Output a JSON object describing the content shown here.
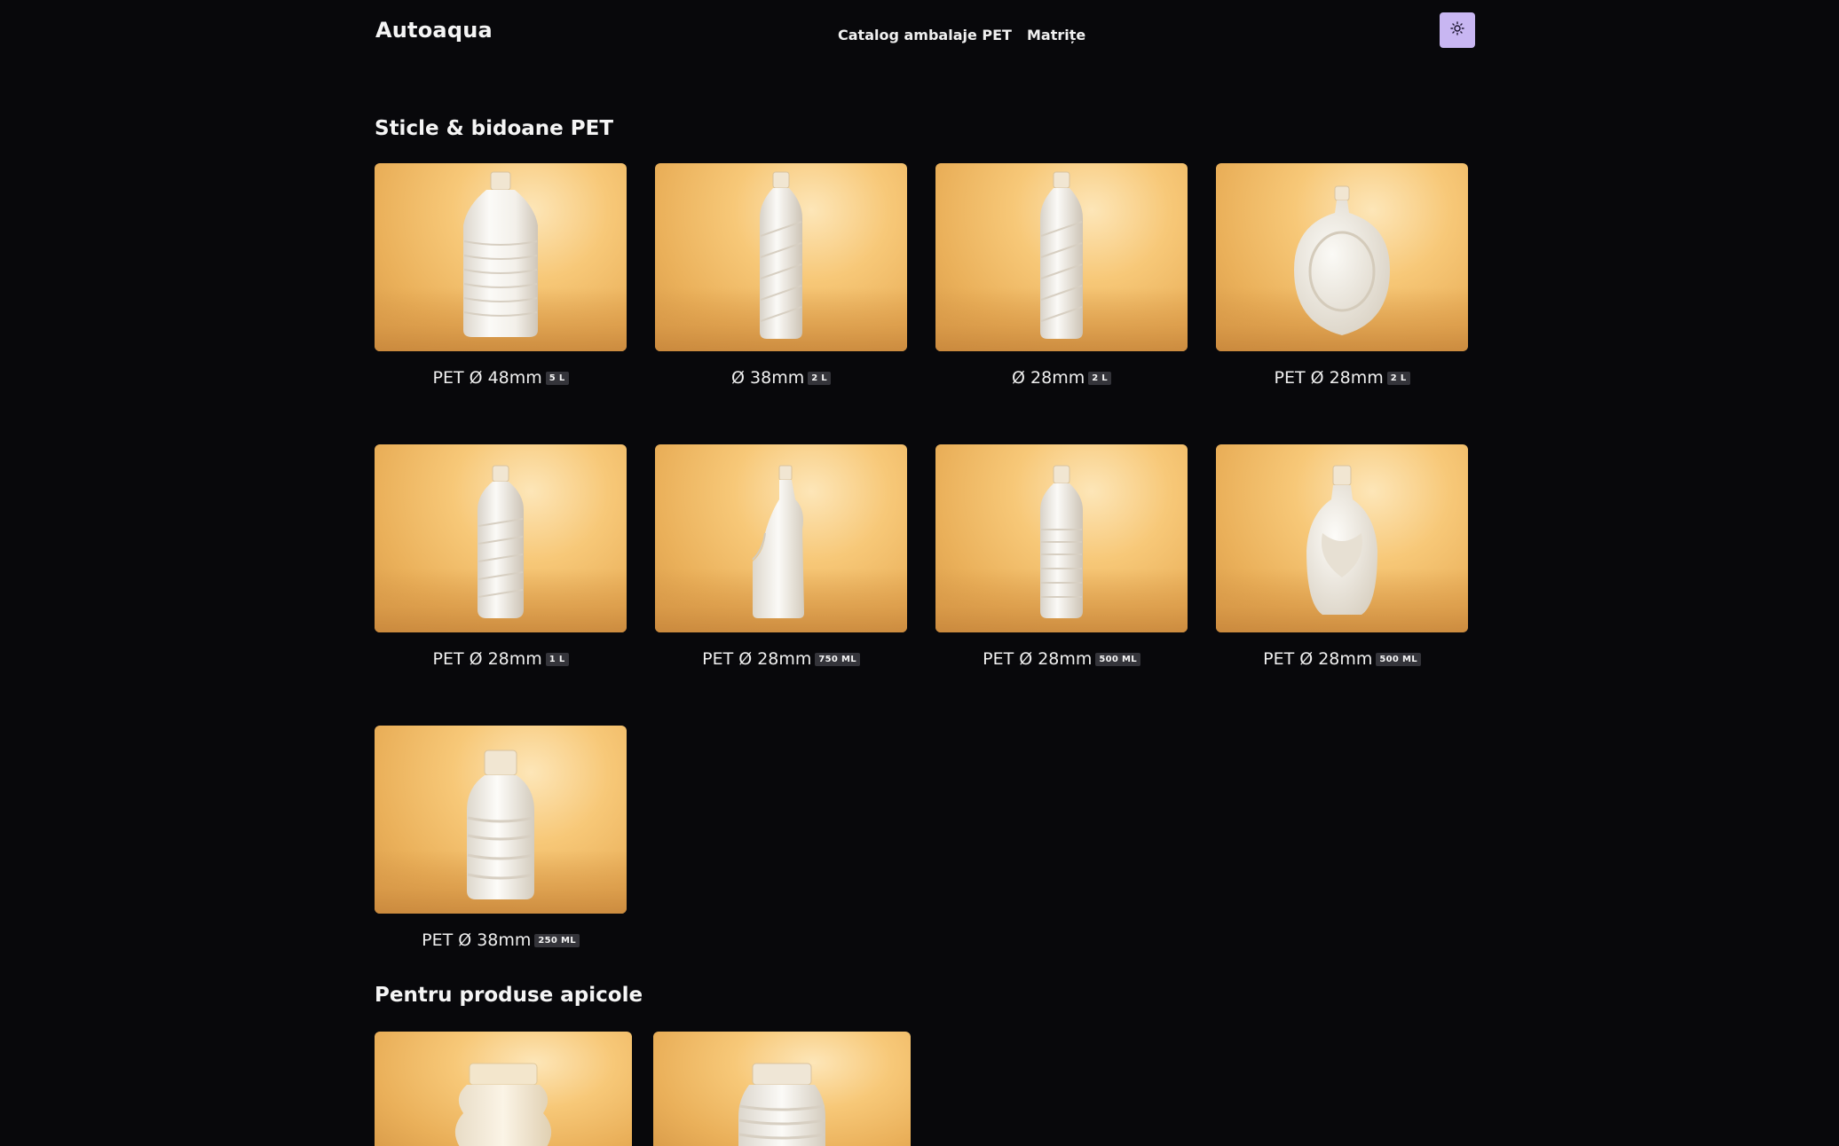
{
  "header": {
    "brand": "Autoaqua",
    "nav": [
      {
        "label": "Catalog ambalaje PET"
      },
      {
        "label": "Matrițe"
      }
    ],
    "theme_toggle_icon": "sun-icon"
  },
  "sections": [
    {
      "title": "Sticle & bidoane PET",
      "products": [
        {
          "name": "PET Ø 48mm",
          "volume": "5 L"
        },
        {
          "name": "Ø 38mm",
          "volume": "2 L"
        },
        {
          "name": "Ø 28mm",
          "volume": "2 L"
        },
        {
          "name": "PET Ø 28mm",
          "volume": "2 L"
        },
        {
          "name": "PET Ø 28mm",
          "volume": "1 L"
        },
        {
          "name": "PET Ø 28mm",
          "volume": "750 ML"
        },
        {
          "name": "PET Ø 28mm",
          "volume": "500 ML"
        },
        {
          "name": "PET Ø 28mm",
          "volume": "500 ML"
        },
        {
          "name": "PET Ø 38mm",
          "volume": "250 ML"
        }
      ]
    },
    {
      "title": "Pentru produse apicole",
      "products": [
        {
          "name": "",
          "volume": ""
        },
        {
          "name": "",
          "volume": ""
        }
      ]
    }
  ],
  "colors": {
    "background": "#08080b",
    "accent": "#c8b6f2",
    "badge": "#34343a"
  }
}
